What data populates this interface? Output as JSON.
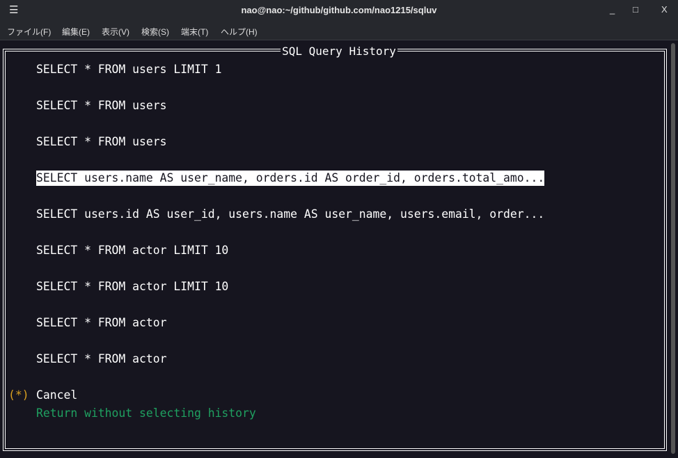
{
  "window": {
    "title": "nao@nao:~/github/github.com/nao1215/sqluv",
    "minimize": "_",
    "maximize": "□",
    "close": "X"
  },
  "menu": [
    "ファイル(F)",
    "編集(E)",
    "表示(V)",
    "検索(S)",
    "端末(T)",
    "ヘルプ(H)"
  ],
  "dialog": {
    "title": "SQL Query History",
    "items": [
      "SELECT * FROM users LIMIT 1",
      "SELECT * FROM users",
      "SELECT * FROM users",
      "SELECT users.name AS user_name, orders.id AS order_id, orders.total_amo...",
      "SELECT users.id AS user_id, users.name AS user_name, users.email, order...",
      "SELECT * FROM actor LIMIT 10",
      "SELECT * FROM actor LIMIT 10",
      "SELECT * FROM actor",
      "SELECT * FROM actor"
    ],
    "selected_index": 3,
    "cancel": {
      "marker": "(*)",
      "label": "Cancel",
      "description": "Return without selecting history"
    }
  },
  "colors": {
    "marker": "#d9a020",
    "description": "#1fa060"
  }
}
